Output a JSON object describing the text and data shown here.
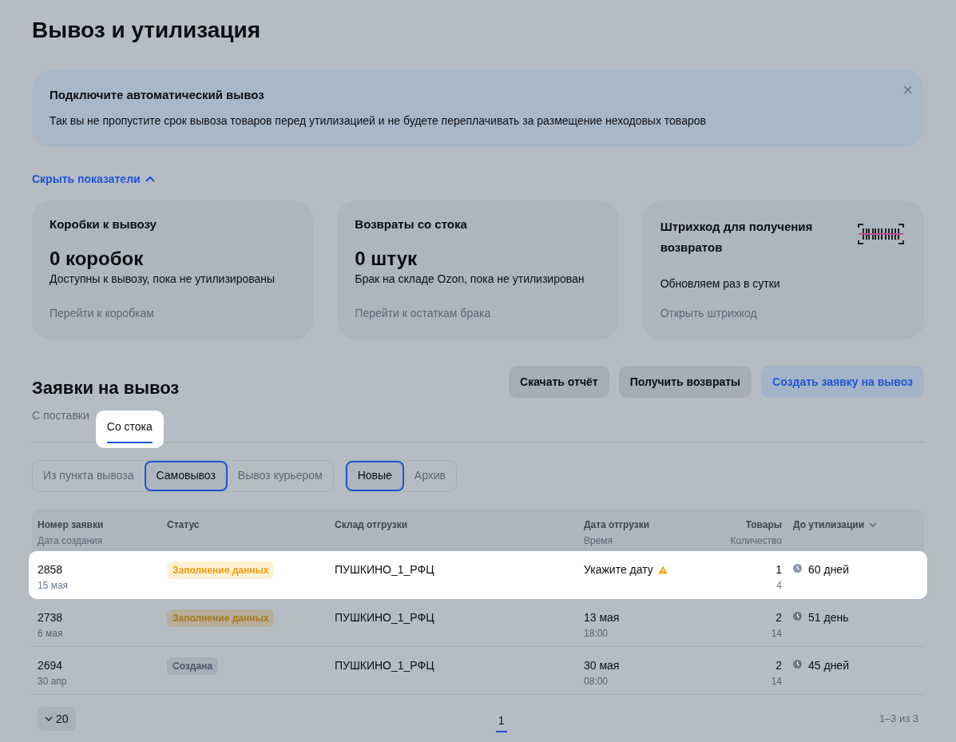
{
  "title": "Вывоз и утилизация",
  "banner": {
    "title": "Подключите автоматический вывоз",
    "text": "Так вы не пропустите срок вывоза товаров перед утилизацией и не будете переплачивать за размещение неходовых товаров",
    "close": "×"
  },
  "toggle": {
    "label": "Скрыть показатели",
    "expanded": true
  },
  "cards": [
    {
      "kind": "stat",
      "title": "Коробки к вывозу",
      "value": "0 коробок",
      "text": "Доступны к вывозу, пока не утилизированы",
      "link": "Перейти к коробкам"
    },
    {
      "kind": "stat",
      "title": "Возвраты со стока",
      "value": "0 штук",
      "text": "Брак на складе Ozon, пока не утилизирован",
      "link": "Перейти к остаткам брака"
    },
    {
      "kind": "barcode",
      "title": "Штрихкод для получения возвратов",
      "text": "Обновляем раз в сутки",
      "link": "Открыть штрихкод"
    }
  ],
  "section": {
    "title": "Заявки на вывоз",
    "buttons": [
      {
        "label": "Скачать отчёт",
        "primary": false
      },
      {
        "label": "Получить возвраты",
        "primary": false
      },
      {
        "label": "Создать заявку на вывоз",
        "primary": true
      }
    ]
  },
  "tabs": [
    {
      "label": "С поставки",
      "selected": false
    },
    {
      "label": "Со стока",
      "selected": true
    }
  ],
  "filters": [
    [
      {
        "label": "Из пункта вывоза",
        "selected": false
      },
      {
        "label": "Самовывоз",
        "selected": true
      },
      {
        "label": "Вывоз курьером",
        "selected": false
      }
    ],
    [
      {
        "label": "Новые",
        "selected": true
      },
      {
        "label": "Архив",
        "selected": false
      }
    ]
  ],
  "table": {
    "columns": [
      {
        "title": "Номер заявки",
        "subtitle": "Дата создания"
      },
      {
        "title": "Статус"
      },
      {
        "title": "Склад отгрузки"
      },
      {
        "title": "Дата отгрузки",
        "subtitle": "Время"
      },
      {
        "title": "Товары",
        "subtitle": "Количество"
      },
      {
        "title": "До утилизации",
        "sortable": true
      }
    ],
    "rows": [
      {
        "highlighted": true,
        "number": "2858",
        "created": "15 мая",
        "status": {
          "kind": "filling",
          "label": "Заполнение данных"
        },
        "warehouse": "ПУШКИНО_1_РФЦ",
        "date": "Укажите дату",
        "warning": true,
        "items": "1",
        "quantity": "4",
        "until": "60 дней"
      },
      {
        "highlighted": false,
        "number": "2738",
        "created": "6 мая",
        "status": {
          "kind": "filling",
          "label": "Заполнение данных"
        },
        "warehouse": "ПУШКИНО_1_РФЦ",
        "date": "13 мая",
        "time": "18:00",
        "warning": false,
        "items": "2",
        "quantity": "14",
        "until": "51 день"
      },
      {
        "highlighted": false,
        "number": "2694",
        "created": "30 апр",
        "status": {
          "kind": "created",
          "label": "Создана"
        },
        "warehouse": "ПУШКИНО_1_РФЦ",
        "date": "30 мая",
        "time": "08:00",
        "warning": false,
        "items": "2",
        "quantity": "14",
        "until": "45 дней"
      }
    ]
  },
  "pagination": {
    "page_size": "20",
    "pages": [
      {
        "label": "1",
        "selected": true
      }
    ],
    "range": "1–3 из 3"
  }
}
